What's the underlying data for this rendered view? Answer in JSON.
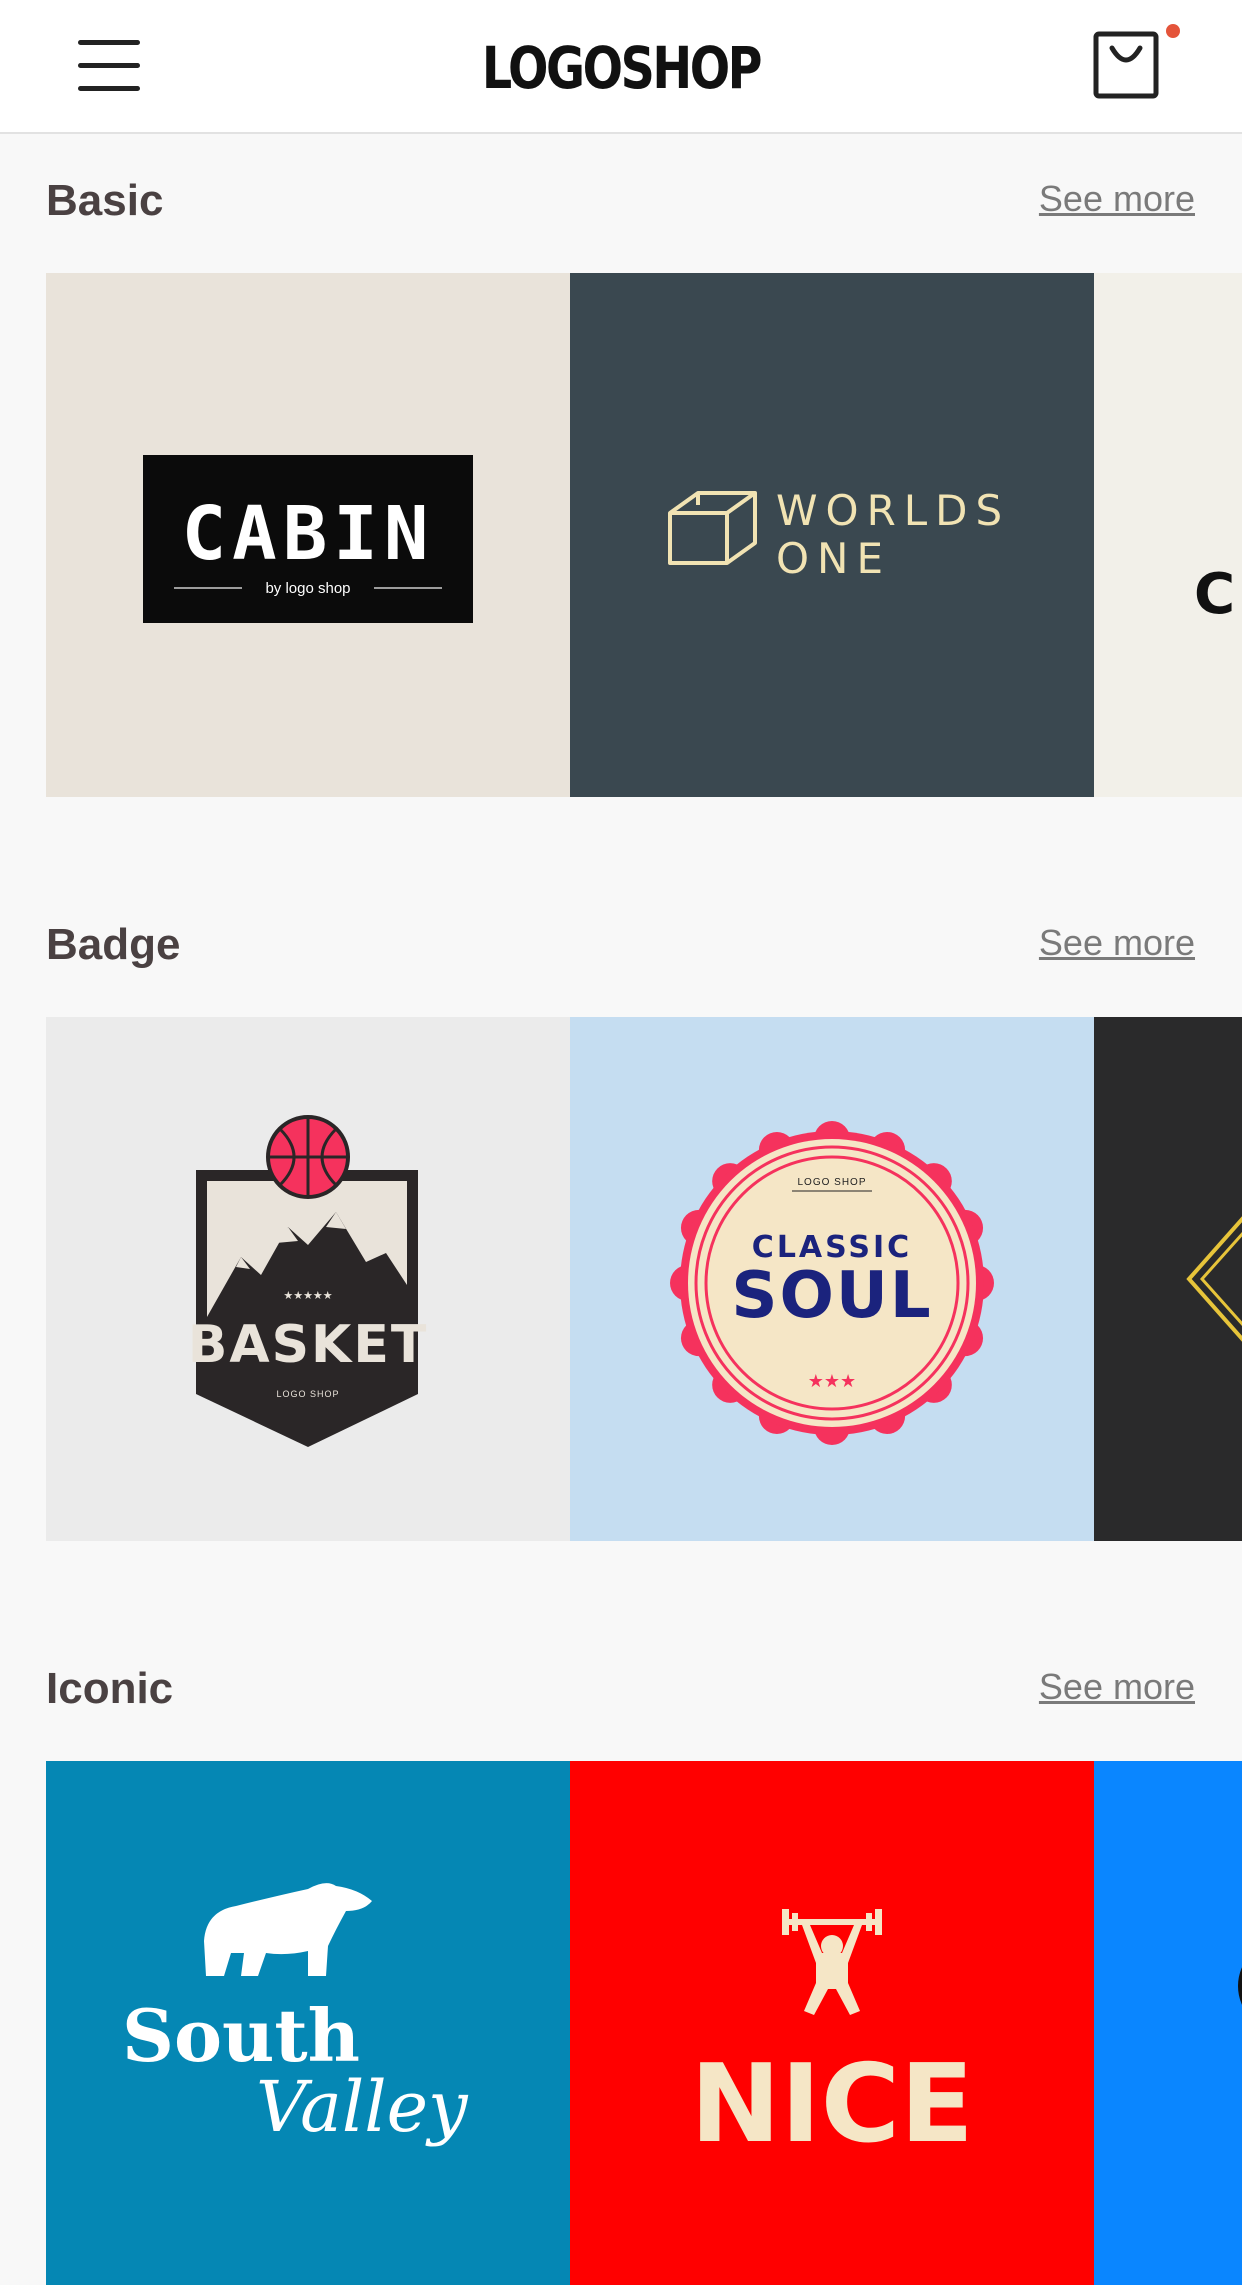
{
  "header": {
    "brand": "LOGOSHOP",
    "menu_icon": "hamburger-menu-icon",
    "cart_icon": "shopping-bag-icon",
    "cart_badge_color": "#e4543a"
  },
  "sections": [
    {
      "title": "Basic",
      "see_more": "See more",
      "tiles": [
        {
          "name": "CABIN",
          "sub": "by logo shop",
          "bg": "#e9e3da"
        },
        {
          "name": "WORLDS",
          "line2": "ONE",
          "bg": "#3a4850"
        },
        {
          "partial_text": "C",
          "bg": "#f2f0e9"
        }
      ]
    },
    {
      "title": "Badge",
      "see_more": "See more",
      "tiles": [
        {
          "name": "BASKET",
          "sub": "LOGO SHOP",
          "stars": "★★★★★",
          "bg": "#ebebeb"
        },
        {
          "top": "LOGO SHOP",
          "line1": "CLASSIC",
          "line2": "SOUL",
          "stars": "★★★",
          "bg": "#c5ddf1"
        },
        {
          "bg": "#2a2a2b",
          "accent": "#e7c43a"
        }
      ]
    },
    {
      "title": "Iconic",
      "see_more": "See more",
      "tiles": [
        {
          "line1": "South",
          "line2": "Valley",
          "bg": "#0587b4"
        },
        {
          "name": "NICE",
          "bg": "#ff0000"
        },
        {
          "bg": "#0a86ff"
        }
      ]
    }
  ]
}
